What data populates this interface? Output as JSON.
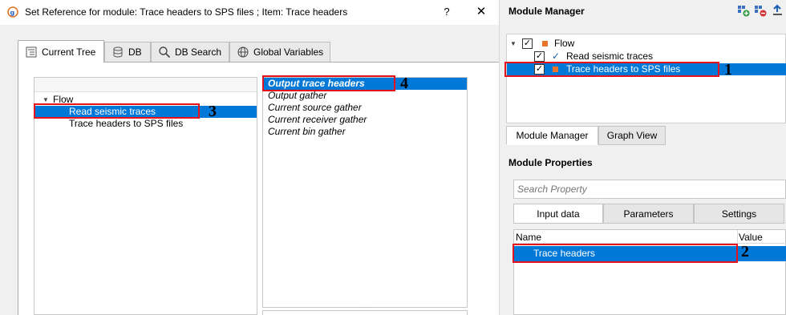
{
  "dialog": {
    "title": "Set Reference for module: Trace headers to SPS files ; Item: Trace headers",
    "help_label": "?",
    "close_label": "✕",
    "tabs": [
      {
        "label": "Current Tree",
        "icon": "tree-icon",
        "active": true
      },
      {
        "label": "DB",
        "icon": "database-icon",
        "active": false
      },
      {
        "label": "DB Search",
        "icon": "search-icon",
        "active": false
      },
      {
        "label": "Global Variables",
        "icon": "globe-icon",
        "active": false
      }
    ],
    "tree": {
      "root": "Flow",
      "items": [
        "Read seismic traces",
        "Trace headers to SPS files"
      ],
      "selected": "Read seismic traces"
    },
    "list": {
      "items": [
        "Output trace headers",
        "Output gather",
        "Current source gather",
        "Current receiver gather",
        "Current bin gather"
      ],
      "selected": "Output trace headers"
    }
  },
  "module_manager": {
    "title": "Module Manager",
    "toolbar_icons": [
      "add-module-icon",
      "remove-module-icon",
      "export-icon"
    ],
    "tree": {
      "root": "Flow",
      "items": [
        "Read seismic traces",
        "Trace headers to SPS files"
      ],
      "selected": "Trace headers to SPS files"
    },
    "tabs": [
      {
        "label": "Module Manager",
        "active": true
      },
      {
        "label": "Graph View",
        "active": false
      }
    ]
  },
  "module_properties": {
    "title": "Module Properties",
    "search_placeholder": "Search Property",
    "tabs": [
      {
        "label": "Input data",
        "active": true
      },
      {
        "label": "Parameters",
        "active": false
      },
      {
        "label": "Settings",
        "active": false
      }
    ],
    "columns": [
      "Name",
      "Value"
    ],
    "rows": [
      {
        "name": "Trace headers",
        "value": ""
      }
    ]
  },
  "annotations": [
    "1",
    "2",
    "3",
    "4"
  ],
  "colors": {
    "selection": "#0078d7",
    "highlight_box": "#e5111b",
    "module_square": "#e8752a"
  }
}
